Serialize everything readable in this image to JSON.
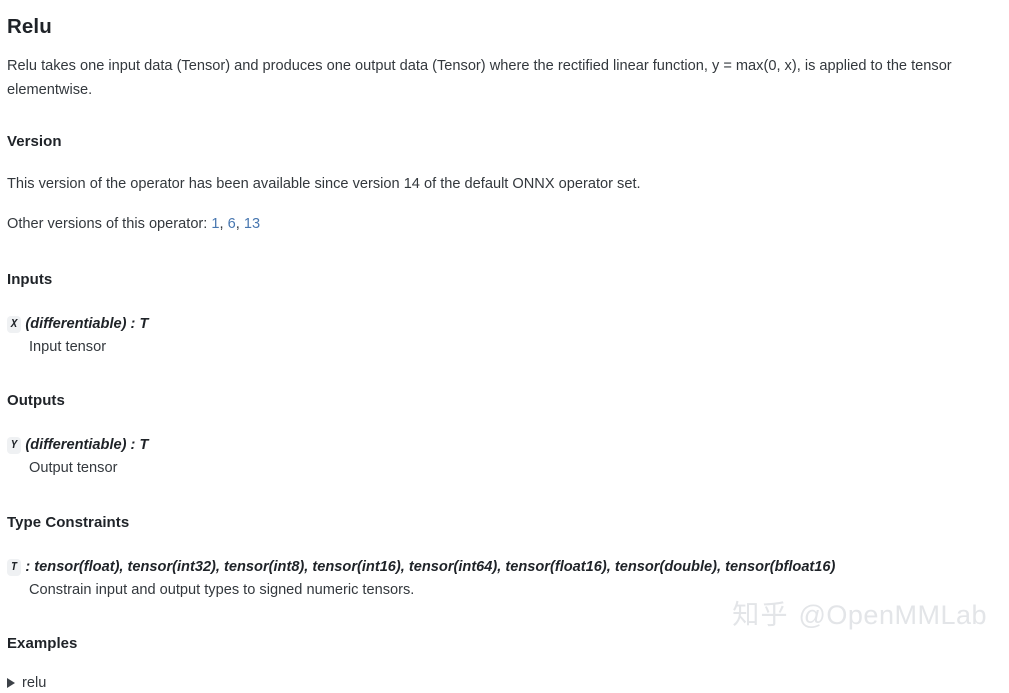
{
  "operator": {
    "title": "Relu",
    "description": "Relu takes one input data (Tensor) and produces one output data (Tensor) where the rectified linear function, y = max(0, x), is applied to the tensor elementwise."
  },
  "version": {
    "heading": "Version",
    "statement": "This version of the operator has been available since version 14 of the default ONNX operator set.",
    "other_versions_label": "Other versions of this operator: ",
    "other_versions": [
      {
        "label": "1",
        "separator": ", "
      },
      {
        "label": "6",
        "separator": ", "
      },
      {
        "label": "13",
        "separator": ""
      }
    ],
    "link_color": "#4877b0"
  },
  "inputs": {
    "heading": "Inputs",
    "entries": [
      {
        "name": "X",
        "signature": "(differentiable) : T",
        "description": "Input tensor"
      }
    ]
  },
  "outputs": {
    "heading": "Outputs",
    "entries": [
      {
        "name": "Y",
        "signature": "(differentiable) : T",
        "description": "Output tensor"
      }
    ]
  },
  "type_constraints": {
    "heading": "Type Constraints",
    "entries": [
      {
        "name": "T",
        "signature": ": tensor(float), tensor(int32), tensor(int8), tensor(int16), tensor(int64), tensor(float16), tensor(double), tensor(bfloat16)",
        "description": "Constrain input and output types to signed numeric tensors."
      }
    ]
  },
  "examples": {
    "heading": "Examples",
    "items": [
      {
        "label": "relu",
        "expanded": false,
        "marker": "disclosure-triangle-right"
      }
    ]
  },
  "watermark": {
    "site": "知乎",
    "handle": "@OpenMMLab",
    "color": "#e3e5e8"
  }
}
